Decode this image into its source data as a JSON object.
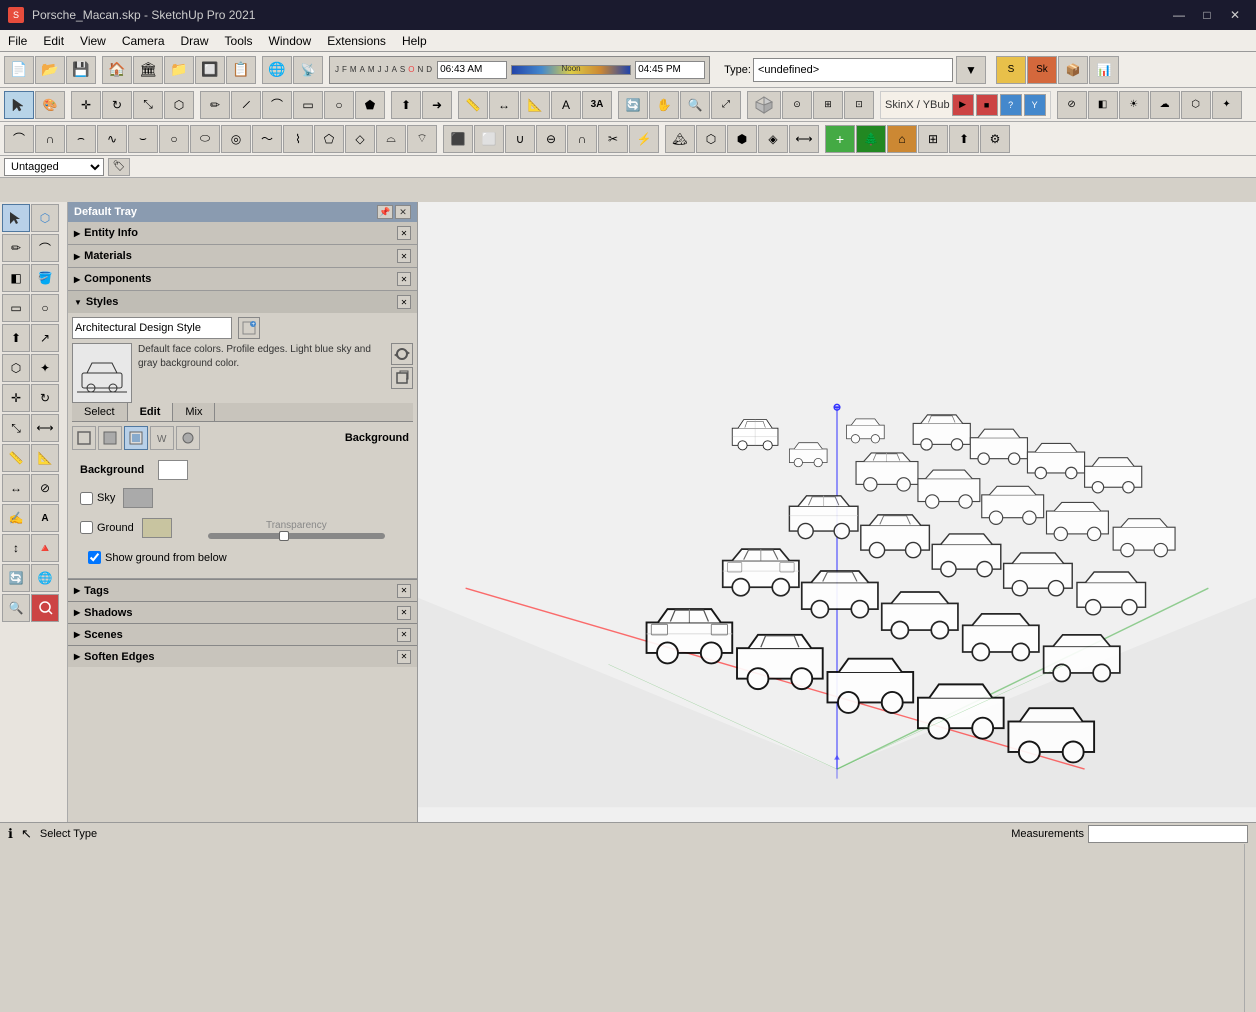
{
  "window": {
    "title": "Porsche_Macan.skp - SketchUp Pro 2021",
    "icon": "su"
  },
  "title_bar": {
    "minimize_label": "—",
    "maximize_label": "□",
    "close_label": "✕"
  },
  "menu": {
    "items": [
      "File",
      "Edit",
      "View",
      "Camera",
      "Draw",
      "Tools",
      "Window",
      "Extensions",
      "Help"
    ]
  },
  "toolbar1": {
    "buttons": [
      "🏠",
      "💾",
      "🏛",
      "📁",
      "🔲",
      "📋",
      "🌐",
      "📡",
      "☁"
    ]
  },
  "time_slider": {
    "months": [
      "J",
      "F",
      "M",
      "A",
      "M",
      "J",
      "J",
      "A",
      "S",
      "O",
      "N",
      "D"
    ],
    "time_start": "06:43 AM",
    "time_noon": "Noon",
    "time_end": "04:45 PM"
  },
  "type_input": {
    "label": "Type:",
    "value": "<undefined>"
  },
  "tag_bar": {
    "selected_tag": "Untagged"
  },
  "tray": {
    "title": "Default Tray",
    "sections": {
      "entity_info": {
        "label": "Entity Info",
        "collapsed": true
      },
      "materials": {
        "label": "Materials",
        "collapsed": true
      },
      "components": {
        "label": "Components",
        "collapsed": true
      },
      "styles": {
        "label": "Styles",
        "expanded": true
      }
    },
    "styles": {
      "style_name": "Architectural Design Style",
      "style_description": "Default face colors. Profile edges. Light blue sky and gray background color.",
      "tabs": [
        "Select",
        "Edit",
        "Mix"
      ],
      "active_tab": "Edit",
      "bg_title": "Background",
      "background": {
        "label": "Background",
        "color": "#ffffff"
      },
      "sky": {
        "label": "Sky",
        "checked": false,
        "color": "#aaaaaa"
      },
      "ground": {
        "label": "Ground",
        "checked": false,
        "color": "#c8c4a0"
      },
      "transparency_label": "Transparency",
      "show_ground_from_below": {
        "label": "Show ground from below",
        "checked": true
      }
    },
    "bottom_sections": [
      {
        "label": "Tags"
      },
      {
        "label": "Shadows"
      },
      {
        "label": "Scenes"
      },
      {
        "label": "Soften Edges"
      }
    ]
  },
  "status_bar": {
    "info_icon": "ℹ",
    "select_type_label": "Select Type",
    "cursor_icon": "↖",
    "measurements_label": "Measurements",
    "measurements_value": ""
  },
  "left_tools": {
    "rows": [
      [
        "↖",
        "✋"
      ],
      [
        "✏",
        "🖊"
      ],
      [
        "□",
        "⬡"
      ],
      [
        "✂",
        "📐"
      ],
      [
        "↔",
        "↕"
      ],
      [
        "🔄",
        "↩"
      ],
      [
        "⟳",
        "⟲"
      ],
      [
        "🎨",
        "🪣"
      ],
      [
        "⊕",
        "⊖"
      ],
      [
        "📏",
        "📐"
      ],
      [
        "🔍",
        "🔎"
      ],
      [
        "👁",
        "🎯"
      ],
      [
        "✍",
        "📝"
      ],
      [
        "📌",
        "A"
      ],
      [
        "↕",
        "🔺"
      ],
      [
        "🏠",
        "🌐"
      ],
      [
        "🔍",
        "🔍"
      ]
    ]
  },
  "viewport": {
    "background_color": "#e8e8e8",
    "description": "3D viewport showing grid of Porsche Macan cars in sketch/line art style"
  }
}
